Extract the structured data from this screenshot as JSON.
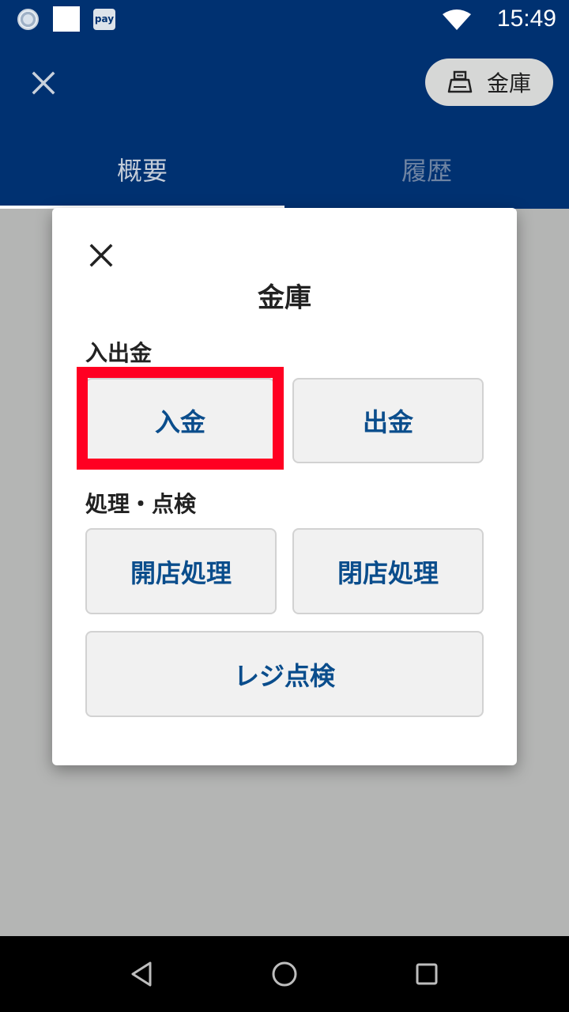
{
  "status_bar": {
    "time": "15:49",
    "pay_badge": "pay",
    "icons": [
      "sync-ring-icon",
      "blank-square-icon",
      "pay-icon",
      "wifi-icon"
    ]
  },
  "app_bar": {
    "close_icon": "close-icon",
    "safe_button_label": "金庫",
    "safe_button_icon": "cash-register-icon",
    "tabs": [
      {
        "label": "概要",
        "selected": true
      },
      {
        "label": "履歴",
        "selected": false
      }
    ]
  },
  "dialog": {
    "title": "金庫",
    "close_icon": "close-icon",
    "section_deposit_withdraw": "入出金",
    "deposit_label": "入金",
    "withdraw_label": "出金",
    "section_process": "処理・点検",
    "open_label": "開店処理",
    "close_label": "閉店処理",
    "register_check_label": "レジ点検"
  },
  "nav_bar": {
    "icons": [
      "back-icon",
      "home-icon",
      "recent-apps-icon"
    ]
  },
  "colors": {
    "primary": "#003171",
    "button_text": "#0a4d8c",
    "highlight": "#ff0022",
    "scrim": "#b4b5b4"
  }
}
